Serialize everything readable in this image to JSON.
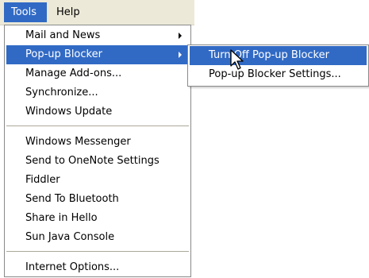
{
  "menubar": {
    "items": [
      {
        "label": "Tools"
      },
      {
        "label": "Help"
      }
    ]
  },
  "tools_menu": {
    "items": [
      {
        "label": "Mail and News",
        "has_submenu": true
      },
      {
        "label": "Pop-up Blocker",
        "has_submenu": true,
        "highlighted": true
      },
      {
        "label": "Manage Add-ons..."
      },
      {
        "label": "Synchronize..."
      },
      {
        "label": "Windows Update"
      },
      {
        "label": "Windows Messenger"
      },
      {
        "label": "Send to OneNote Settings"
      },
      {
        "label": "Fiddler"
      },
      {
        "label": "Send To Bluetooth"
      },
      {
        "label": "Share in Hello"
      },
      {
        "label": "Sun Java Console"
      },
      {
        "label": "Internet Options..."
      }
    ]
  },
  "popup_submenu": {
    "items": [
      {
        "label": "Turn Off Pop-up Blocker",
        "highlighted": true
      },
      {
        "label": "Pop-up Blocker Settings..."
      }
    ]
  },
  "colors": {
    "highlight": "#316ac5",
    "menubar_bg": "#ece9d8",
    "separator": "#aca899"
  },
  "icons": {
    "submenu_arrow": "triangle-right",
    "cursor": "arrow-pointer"
  }
}
